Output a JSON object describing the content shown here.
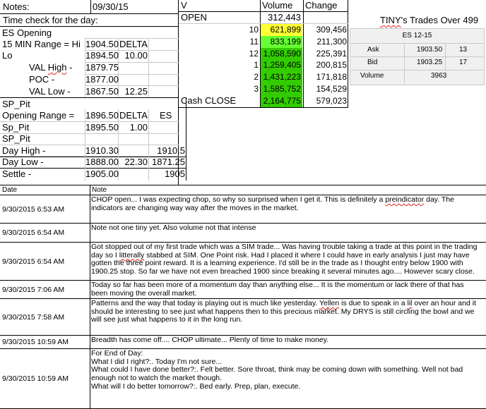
{
  "header": {
    "notes_label": "Notes:",
    "date": "09/30/15",
    "time_check": "Time check for the day:"
  },
  "es": {
    "title": "ES Opening",
    "range_label": "15 MIN Range = Hi",
    "range_hi": "1904.50",
    "delta_label": "DELTA",
    "lo_label": "Lo",
    "range_lo": "1894.50",
    "range_delta": "10.00",
    "val_high_label_a": "VAL ",
    "val_high_label_b": "High",
    "val_high_label_c": " -",
    "val_high": "1879.75",
    "poc_label": "POC    -",
    "poc": "1877.00",
    "val_low_label": "VAL Low    -",
    "val_low": "1867.50",
    "val_low_delta": "12.25"
  },
  "sp": {
    "sp_pit_1": "SP_Pit",
    "opening_range_label": "Opening Range =",
    "opening_range": "1896.50",
    "delta_label": "DELTA",
    "es_label": "ES",
    "sp_pit_2": "Sp_Pit",
    "sp_pit_2_value": "1895.50",
    "sp_pit_2_delta": "1.00",
    "sp_pit_3": "SP_Pit",
    "day_high_label": "Day High -",
    "day_high": "1910.30",
    "day_high_es": "1910.5",
    "day_low_label": "Day Low -",
    "day_low": "1888.00",
    "day_low_delta": "22.30",
    "day_low_es": "1871.25",
    "settle_label": "Settle -",
    "settle": "1905.00",
    "settle_es": "1905"
  },
  "volume_table": {
    "col_v": "V",
    "col_volume": "Volume",
    "col_change": "Change",
    "open_label": "OPEN",
    "open_volume": "312,443",
    "rows": [
      {
        "level": "10",
        "volume": "621,899",
        "change": "309,456",
        "color": "#ffff33"
      },
      {
        "level": "11",
        "volume": "833,199",
        "change": "211,300",
        "color": "#66ff33"
      },
      {
        "level": "12",
        "volume": "1,058,590",
        "change": "225,391",
        "color": "#33cc00"
      },
      {
        "level": "1",
        "volume": "1,259,405",
        "change": "200,815",
        "color": "#33cc00"
      },
      {
        "level": "2",
        "volume": "1,431,223",
        "change": "171,818",
        "color": "#33cc00"
      },
      {
        "level": "3",
        "volume": "1,585,752",
        "change": "154,529",
        "color": "#33cc00"
      }
    ],
    "close_label": "Cash CLOSE",
    "close_volume": "2,164,775",
    "close_change": "579,023",
    "close_color": "#33cc00"
  },
  "tiny": {
    "title_a": "TINY",
    "title_b": "'s Trades Over 499",
    "panel_title": "ES 12-15",
    "ask_label": "Ask",
    "ask": "1903.50",
    "ask_size": "13",
    "bid_label": "Bid",
    "bid": "1903.25",
    "bid_size": "17",
    "volume_label": "Volume",
    "volume": "3963"
  },
  "log": {
    "date_header": "Date",
    "note_header": "Note",
    "entries": [
      {
        "date": "9/30/2015 6:53 AM",
        "lines": [
          "CHOP open... I was expecting chop, so why so surprised when I get it.  This is definitely a ",
          "preindicator",
          " day.  The",
          "indicators are changing way way after the moves in the market."
        ]
      },
      {
        "date": "9/30/2015 6:54 AM",
        "text": "Note not one tiny yet.  Also volume not that intense"
      },
      {
        "date": "9/30/2015 6:54 AM",
        "lines": [
          "Got stopped out of my first trade which was a SIM trade... Was having trouble taking a trade at this point in the trading",
          "day so I ",
          "litterally",
          " stabbed at SIM.  One Point risk.  Had I placed it where I could have in early analysis I just may have",
          "gotten the three point reward.  It is a learning experience.  I'd still be in the trade as I thought entry below 1900 with",
          "1900.25 stop.  So far we have not even breached 1900 since breaking it several minutes ago.... However scary close."
        ]
      },
      {
        "date": "9/30/2015 7:06 AM",
        "lines": [
          "Today so far has been more of a momentum day than anything else... It is the momentum or lack there of that has",
          "been moving the overall market."
        ]
      },
      {
        "date": "9/30/2015 7:58 AM",
        "lines": [
          "Patterns and the way that today is playing out is much like yesterday.  ",
          "Yellen",
          " is due to speak in a ",
          "lil",
          " over an hour and it",
          "should be interesting to see just what happens then to this precious market.  My DRYS is still circling the bowl and we",
          "will see just what happens to it in the long run."
        ]
      },
      {
        "date": "9/30/2015 10:59 AM",
        "text": "Breadth has come off.... CHOP ultimate... Plenty of time to make money."
      },
      {
        "date": "9/30/2015 10:59 AM",
        "lines": [
          "For End of Day:",
          "What I did I right?:.  Today I'm not sure...",
          "What could I have done better?:.  Felt better.  Sore throat, think may be coming down with something.  Well not bad",
          "enough not to watch the market though.",
          "What will I do better tomorrow?:.  Bed early.  Prep, plan, execute."
        ]
      }
    ]
  }
}
